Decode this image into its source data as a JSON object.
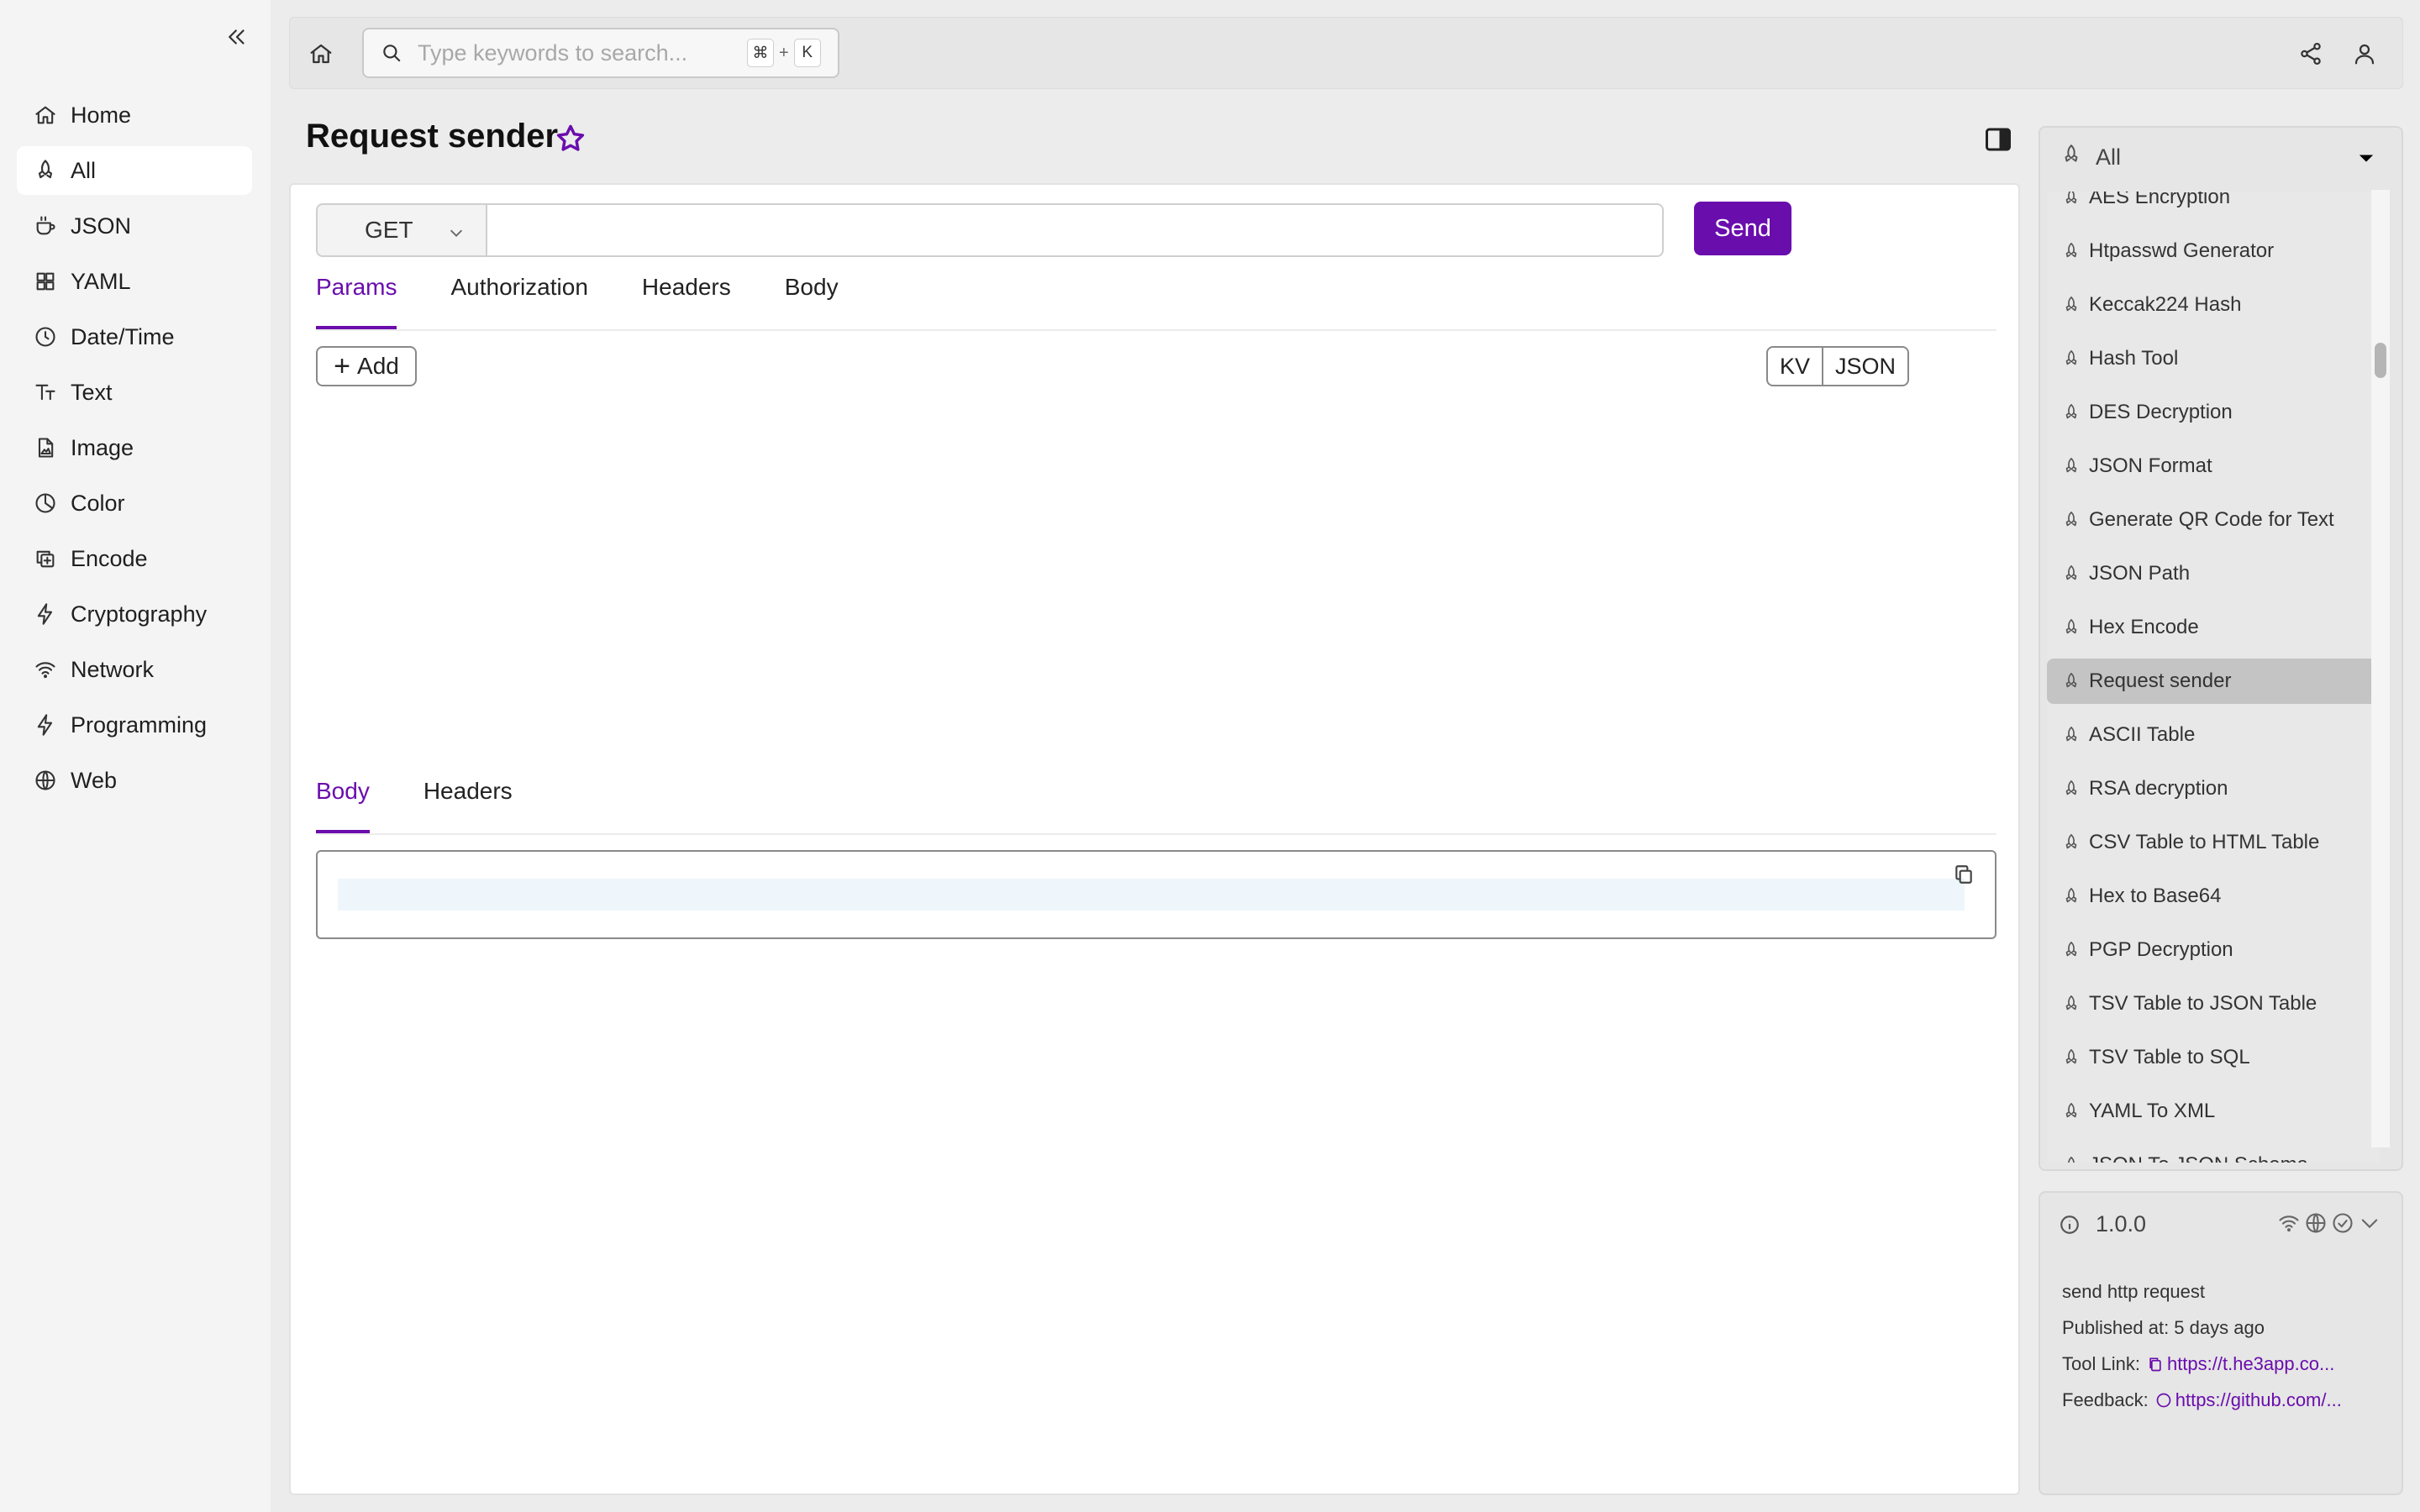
{
  "sidebar": {
    "items": [
      {
        "label": "Home",
        "icon": "home-icon",
        "active": false
      },
      {
        "label": "All",
        "icon": "rocket-icon",
        "active": true
      },
      {
        "label": "JSON",
        "icon": "cup-icon",
        "active": false
      },
      {
        "label": "YAML",
        "icon": "grid-icon",
        "active": false
      },
      {
        "label": "Date/Time",
        "icon": "clock-icon",
        "active": false
      },
      {
        "label": "Text",
        "icon": "text-icon",
        "active": false
      },
      {
        "label": "Image",
        "icon": "image-file-icon",
        "active": false
      },
      {
        "label": "Color",
        "icon": "pie-icon",
        "active": false
      },
      {
        "label": "Encode",
        "icon": "copy-icon",
        "active": false
      },
      {
        "label": "Cryptography",
        "icon": "bolt-icon",
        "active": false
      },
      {
        "label": "Network",
        "icon": "wifi-icon",
        "active": false
      },
      {
        "label": "Programming",
        "icon": "bolt-icon",
        "active": false
      },
      {
        "label": "Web",
        "icon": "globe-icon",
        "active": false
      }
    ]
  },
  "search": {
    "placeholder": "Type keywords to search...",
    "shortcut_mod": "⌘",
    "shortcut_plus": "+",
    "shortcut_key": "K"
  },
  "page": {
    "title": "Request sender"
  },
  "request": {
    "method": "GET",
    "url": "",
    "send_label": "Send",
    "tabs": [
      "Params",
      "Authorization",
      "Headers",
      "Body"
    ],
    "active_tab": "Params",
    "add_label": "Add",
    "mode_kv": "KV",
    "mode_json": "JSON"
  },
  "response": {
    "tabs": [
      "Body",
      "Headers"
    ],
    "active_tab": "Body"
  },
  "tools": {
    "filter": "All",
    "items": [
      "AES Encryption",
      "Htpasswd Generator",
      "Keccak224 Hash",
      "Hash Tool",
      "DES Decryption",
      "JSON Format",
      "Generate QR Code for Text",
      "JSON Path",
      "Hex Encode",
      "Request sender",
      "ASCII Table",
      "RSA decryption",
      "CSV Table to HTML Table",
      "Hex to Base64",
      "PGP Decryption",
      "TSV Table to JSON Table",
      "TSV Table to SQL",
      "YAML To XML",
      "JSON To JSON Schema"
    ],
    "active": "Request sender"
  },
  "info": {
    "version": "1.0.0",
    "description": "send http request",
    "published": "Published at: 5 days ago",
    "tool_link_label": "Tool Link:",
    "tool_link": "https://t.he3app.co...",
    "feedback_label": "Feedback:",
    "feedback_link": "https://github.com/..."
  },
  "colors": {
    "accent": "#6a0dad",
    "active_tool_bg": "#c4c4c4"
  }
}
